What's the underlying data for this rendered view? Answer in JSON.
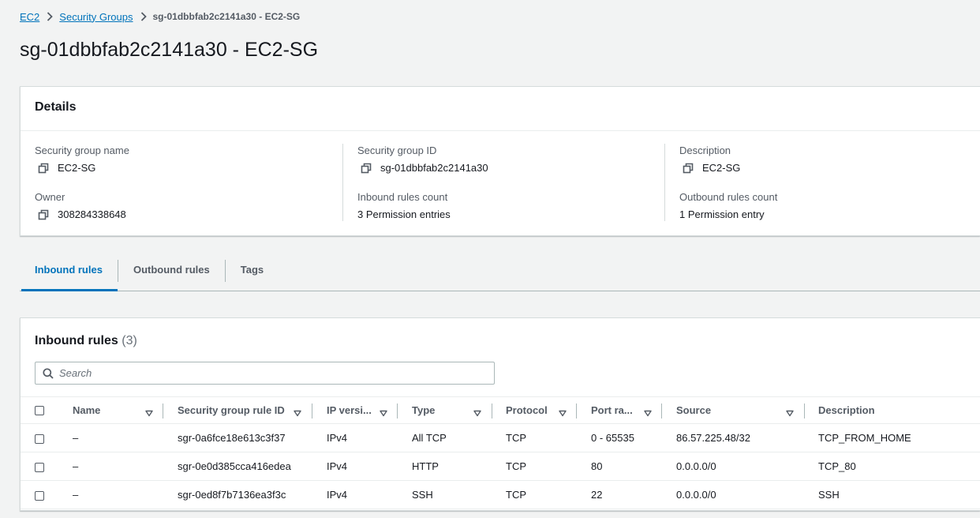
{
  "breadcrumb": {
    "items": [
      "EC2",
      "Security Groups"
    ],
    "current": "sg-01dbbfab2c2141a30 - EC2-SG"
  },
  "page_title": "sg-01dbbfab2c2141a30 - EC2-SG",
  "details": {
    "heading": "Details",
    "fields": [
      {
        "label": "Security group name",
        "value": "EC2-SG",
        "copyable": true
      },
      {
        "label": "Security group ID",
        "value": "sg-01dbbfab2c2141a30",
        "copyable": true
      },
      {
        "label": "Description",
        "value": "EC2-SG",
        "copyable": true
      },
      {
        "label": "Owner",
        "value": "308284338648",
        "copyable": true
      },
      {
        "label": "Inbound rules count",
        "value": "3 Permission entries",
        "copyable": false
      },
      {
        "label": "Outbound rules count",
        "value": "1 Permission entry",
        "copyable": false
      }
    ]
  },
  "tabs": [
    {
      "label": "Inbound rules",
      "active": true
    },
    {
      "label": "Outbound rules",
      "active": false
    },
    {
      "label": "Tags",
      "active": false
    }
  ],
  "inbound": {
    "title": "Inbound rules",
    "count": "(3)",
    "search_placeholder": "Search",
    "columns": [
      "Name",
      "Security group rule ID",
      "IP versi...",
      "Type",
      "Protocol",
      "Port ra...",
      "Source",
      "Description"
    ],
    "rows": [
      {
        "name": "–",
        "rule_id": "sgr-0a6fce18e613c3f37",
        "ip_version": "IPv4",
        "type": "All TCP",
        "protocol": "TCP",
        "port_range": "0 - 65535",
        "source": "86.57.225.48/32",
        "description": "TCP_FROM_HOME"
      },
      {
        "name": "–",
        "rule_id": "sgr-0e0d385cca416edea",
        "ip_version": "IPv4",
        "type": "HTTP",
        "protocol": "TCP",
        "port_range": "80",
        "source": "0.0.0.0/0",
        "description": "TCP_80"
      },
      {
        "name": "–",
        "rule_id": "sgr-0ed8f7b7136ea3f3c",
        "ip_version": "IPv4",
        "type": "SSH",
        "protocol": "TCP",
        "port_range": "22",
        "source": "0.0.0.0/0",
        "description": "SSH"
      }
    ]
  },
  "colors": {
    "link": "#0073bb",
    "text": "#16191f",
    "muted": "#545b64",
    "background": "#f2f3f3",
    "border": "#d5dbdb"
  }
}
